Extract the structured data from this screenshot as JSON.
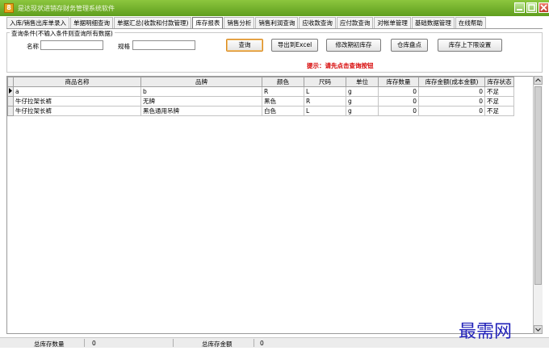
{
  "window": {
    "title": "是达现状进销存财务管理系统软件",
    "icon_glyph": "8"
  },
  "tabs": [
    {
      "label": "入库/销售出库单录入",
      "active": false
    },
    {
      "label": "单据明细查询",
      "active": false
    },
    {
      "label": "单据汇总(收款和付款管理)",
      "active": false
    },
    {
      "label": "库存报表",
      "active": true
    },
    {
      "label": "销售分析",
      "active": false
    },
    {
      "label": "销售利润查询",
      "active": false
    },
    {
      "label": "应收款查询",
      "active": false
    },
    {
      "label": "应付款查询",
      "active": false
    },
    {
      "label": "对帐单管理",
      "active": false
    },
    {
      "label": "基础数据管理",
      "active": false
    },
    {
      "label": "在线帮助",
      "active": false
    }
  ],
  "query": {
    "legend": "查询条件(不输入条件则查询所有数据)",
    "name_label": "名称",
    "name_value": "",
    "spec_label": "规格",
    "spec_value": "",
    "buttons": {
      "search": "查询",
      "export": "导出到Excel",
      "edit_initial": "修改期初库存",
      "stocktake": "仓库盘点",
      "limits": "库存上下限设置"
    },
    "hint": "提示：请先点击查询按钮"
  },
  "table": {
    "columns": [
      "商品名称",
      "品牌",
      "颜色",
      "尺码",
      "单位",
      "库存数量",
      "库存金额(成本金额)",
      "库存状态"
    ],
    "rows": [
      {
        "selected": true,
        "cells": [
          "a",
          "b",
          "R",
          "L",
          "g",
          "0",
          "0",
          "不足"
        ]
      },
      {
        "selected": false,
        "cells": [
          "牛仔拉架长裤",
          "无牌",
          "黑色",
          "R",
          "g",
          "0",
          "0",
          "不足"
        ]
      },
      {
        "selected": false,
        "cells": [
          "牛仔拉架长裤",
          "黑色通用吊牌",
          "白色",
          "L",
          "g",
          "0",
          "0",
          "不足"
        ]
      }
    ]
  },
  "status": {
    "qty_label": "总库存数量",
    "qty_value": "0",
    "amount_label": "总库存金额",
    "amount_value": "0"
  },
  "watermark": "最需网",
  "colors": {
    "titlebar": "#6faf2a",
    "hint": "#d60000",
    "watermark": "#2020b8"
  }
}
